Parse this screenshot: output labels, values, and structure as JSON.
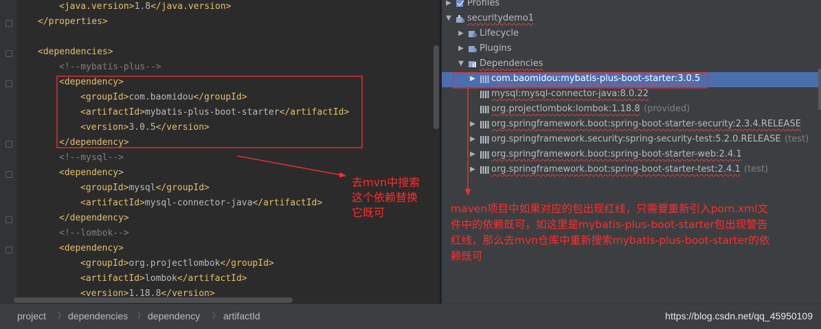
{
  "editor": {
    "lines": [
      {
        "indent": 3,
        "parts": [
          [
            "t",
            "<java.version>"
          ],
          [
            "x",
            "1.8"
          ],
          [
            "t",
            "</java.version>"
          ]
        ]
      },
      {
        "indent": 2,
        "parts": [
          [
            "t",
            "</properties>"
          ]
        ]
      },
      {
        "indent": 0,
        "parts": []
      },
      {
        "indent": 2,
        "parts": [
          [
            "t",
            "<dependencies>"
          ]
        ]
      },
      {
        "indent": 3,
        "parts": [
          [
            "c",
            "<!--mybatis-plus-->"
          ]
        ]
      },
      {
        "indent": 3,
        "parts": [
          [
            "t",
            "<dependency>"
          ]
        ]
      },
      {
        "indent": 4,
        "parts": [
          [
            "t",
            "<groupId>"
          ],
          [
            "x",
            "com.baomidou"
          ],
          [
            "t",
            "</groupId>"
          ]
        ]
      },
      {
        "indent": 4,
        "parts": [
          [
            "t",
            "<artifactId>"
          ],
          [
            "x",
            "mybatis-plus-boot-starter"
          ],
          [
            "t",
            "</artifactId>"
          ]
        ]
      },
      {
        "indent": 4,
        "parts": [
          [
            "t",
            "<version>"
          ],
          [
            "x",
            "3.0.5"
          ],
          [
            "t",
            "</version>"
          ]
        ]
      },
      {
        "indent": 3,
        "parts": [
          [
            "t",
            "</dependency>"
          ]
        ]
      },
      {
        "indent": 3,
        "parts": [
          [
            "c",
            "<!--mysql-->"
          ]
        ]
      },
      {
        "indent": 3,
        "parts": [
          [
            "t",
            "<dependency>"
          ]
        ]
      },
      {
        "indent": 4,
        "parts": [
          [
            "t",
            "<groupId>"
          ],
          [
            "x",
            "mysql"
          ],
          [
            "t",
            "</groupId>"
          ]
        ]
      },
      {
        "indent": 4,
        "parts": [
          [
            "t",
            "<artifactId>"
          ],
          [
            "x",
            "mysql-connector-java"
          ],
          [
            "t",
            "</artifactId>"
          ]
        ]
      },
      {
        "indent": 3,
        "parts": [
          [
            "t",
            "</dependency>"
          ]
        ]
      },
      {
        "indent": 3,
        "parts": [
          [
            "c",
            "<!--lombok-->"
          ]
        ]
      },
      {
        "indent": 3,
        "parts": [
          [
            "t",
            "<dependency>"
          ]
        ]
      },
      {
        "indent": 4,
        "parts": [
          [
            "t",
            "<groupId>"
          ],
          [
            "x",
            "org.projectlombok"
          ],
          [
            "t",
            "</groupId>"
          ]
        ]
      },
      {
        "indent": 4,
        "parts": [
          [
            "t",
            "<artifactId>"
          ],
          [
            "x",
            "lombok"
          ],
          [
            "t",
            "</artifactId>"
          ]
        ]
      },
      {
        "indent": 4,
        "parts": [
          [
            "t",
            "<version>"
          ],
          [
            "x",
            "1.18.8"
          ],
          [
            "t",
            "</version>"
          ]
        ]
      }
    ]
  },
  "maven_tree": {
    "rows": [
      {
        "level": 0,
        "arrow": "right",
        "icon": "profiles-icon",
        "label": "Profiles",
        "squiggle": false,
        "scope": ""
      },
      {
        "level": 0,
        "arrow": "down",
        "icon": "module-icon",
        "label": "securitydemo1",
        "squiggle": true,
        "scope": ""
      },
      {
        "level": 1,
        "arrow": "right",
        "icon": "lifecycle-icon",
        "label": "Lifecycle",
        "squiggle": false,
        "scope": ""
      },
      {
        "level": 1,
        "arrow": "right",
        "icon": "plugins-icon",
        "label": "Plugins",
        "squiggle": false,
        "scope": ""
      },
      {
        "level": 1,
        "arrow": "down",
        "icon": "dependencies-icon",
        "label": "Dependencies",
        "squiggle": true,
        "scope": ""
      },
      {
        "level": 2,
        "arrow": "right",
        "icon": "library-icon",
        "label": "com.baomidou:mybatis-plus-boot-starter:3.0.5",
        "squiggle": true,
        "scope": "",
        "selected": true
      },
      {
        "level": 2,
        "arrow": "",
        "icon": "library-icon",
        "label": "mysql:mysql-connector-java:8.0.22",
        "squiggle": true,
        "scope": ""
      },
      {
        "level": 2,
        "arrow": "",
        "icon": "library-icon",
        "label": "org.projectlombok:lombok:1.18.8",
        "squiggle": true,
        "scope": "(provided)"
      },
      {
        "level": 2,
        "arrow": "right",
        "icon": "library-icon",
        "label": "org.springframework.boot:spring-boot-starter-security:2.3.4.RELEASE",
        "squiggle": true,
        "scope": ""
      },
      {
        "level": 2,
        "arrow": "right",
        "icon": "library-icon",
        "label": "org.springframework.security:spring-security-test:5.2.0.RELEASE",
        "squiggle": false,
        "scope": "(test)"
      },
      {
        "level": 2,
        "arrow": "right",
        "icon": "library-icon",
        "label": "org.springframework.boot:spring-boot-starter-web:2.4.1",
        "squiggle": true,
        "scope": ""
      },
      {
        "level": 2,
        "arrow": "right",
        "icon": "library-icon",
        "label": "org.springframework.boot:spring-boot-starter-test:2.4.1",
        "squiggle": true,
        "scope": "(test)"
      }
    ]
  },
  "annotations": {
    "left_note": [
      "去mvn中搜索",
      "这个依赖替换",
      "它既可"
    ],
    "right_note": [
      "maven项目中如果对应的包出现红线，只需要重新引入pom.xml文",
      "件中的依赖既可，如这里是mybatis-plus-boot-starter包出现警告",
      "红线，那么去mvn仓库中重新搜索mybatis-plus-boot-starter的依",
      "赖既可"
    ]
  },
  "breadcrumb": [
    "project",
    "dependencies",
    "dependency",
    "artifactId"
  ],
  "watermark": "https://blog.csdn.net/qq_45950109",
  "colors": {
    "editor_bg": "#2b2b2b",
    "tag": "#e8bf6a",
    "comment": "#808080",
    "panel_bg": "#3c3f41",
    "selection": "#4b6eaf",
    "annotation_red": "#ff2d2d"
  }
}
